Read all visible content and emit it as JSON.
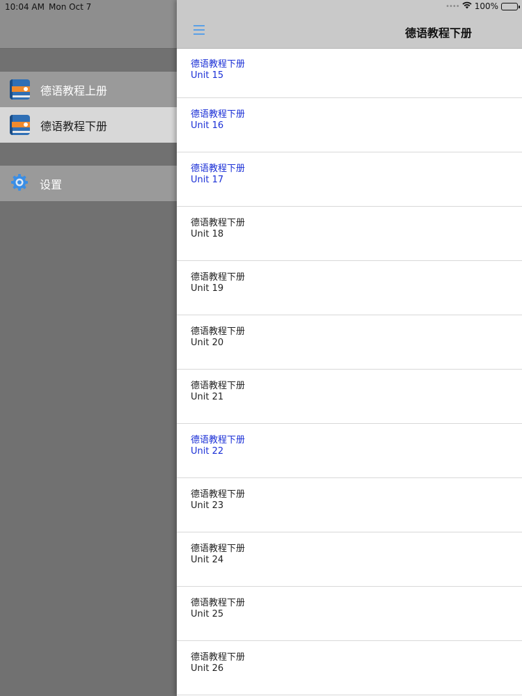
{
  "status_bar": {
    "time": "10:04 AM",
    "date": "Mon Oct 7",
    "battery": "100%"
  },
  "sidebar": {
    "items": [
      {
        "label": "德语教程上册",
        "icon": "book-icon",
        "selected": false
      },
      {
        "label": "德语教程下册",
        "icon": "book-icon",
        "selected": true
      }
    ],
    "settings": {
      "label": "设置",
      "icon": "gear-icon"
    }
  },
  "navbar": {
    "title": "德语教程下册",
    "menu_icon": "hamburger-menu-icon"
  },
  "list": {
    "rows": [
      {
        "title": "德语教程下册",
        "subtitle": "Unit 15",
        "highlighted": true
      },
      {
        "title": "德语教程下册",
        "subtitle": "Unit 16",
        "highlighted": true
      },
      {
        "title": "德语教程下册",
        "subtitle": "Unit 17",
        "highlighted": true
      },
      {
        "title": "德语教程下册",
        "subtitle": "Unit 18",
        "highlighted": false
      },
      {
        "title": "德语教程下册",
        "subtitle": "Unit 19",
        "highlighted": false
      },
      {
        "title": "德语教程下册",
        "subtitle": "Unit 20",
        "highlighted": false
      },
      {
        "title": "德语教程下册",
        "subtitle": "Unit 21",
        "highlighted": false
      },
      {
        "title": "德语教程下册",
        "subtitle": "Unit 22",
        "highlighted": true
      },
      {
        "title": "德语教程下册",
        "subtitle": "Unit 23",
        "highlighted": false
      },
      {
        "title": "德语教程下册",
        "subtitle": "Unit 24",
        "highlighted": false
      },
      {
        "title": "德语教程下册",
        "subtitle": "Unit 25",
        "highlighted": false
      },
      {
        "title": "德语教程下册",
        "subtitle": "Unit 26",
        "highlighted": false
      }
    ]
  },
  "colors": {
    "link_text": "#1a2fd6",
    "normal_text": "#222222",
    "menu_icon": "#5aa0e6",
    "sidebar_bg": "#717171",
    "navbar_bg": "#c9c9c9"
  }
}
